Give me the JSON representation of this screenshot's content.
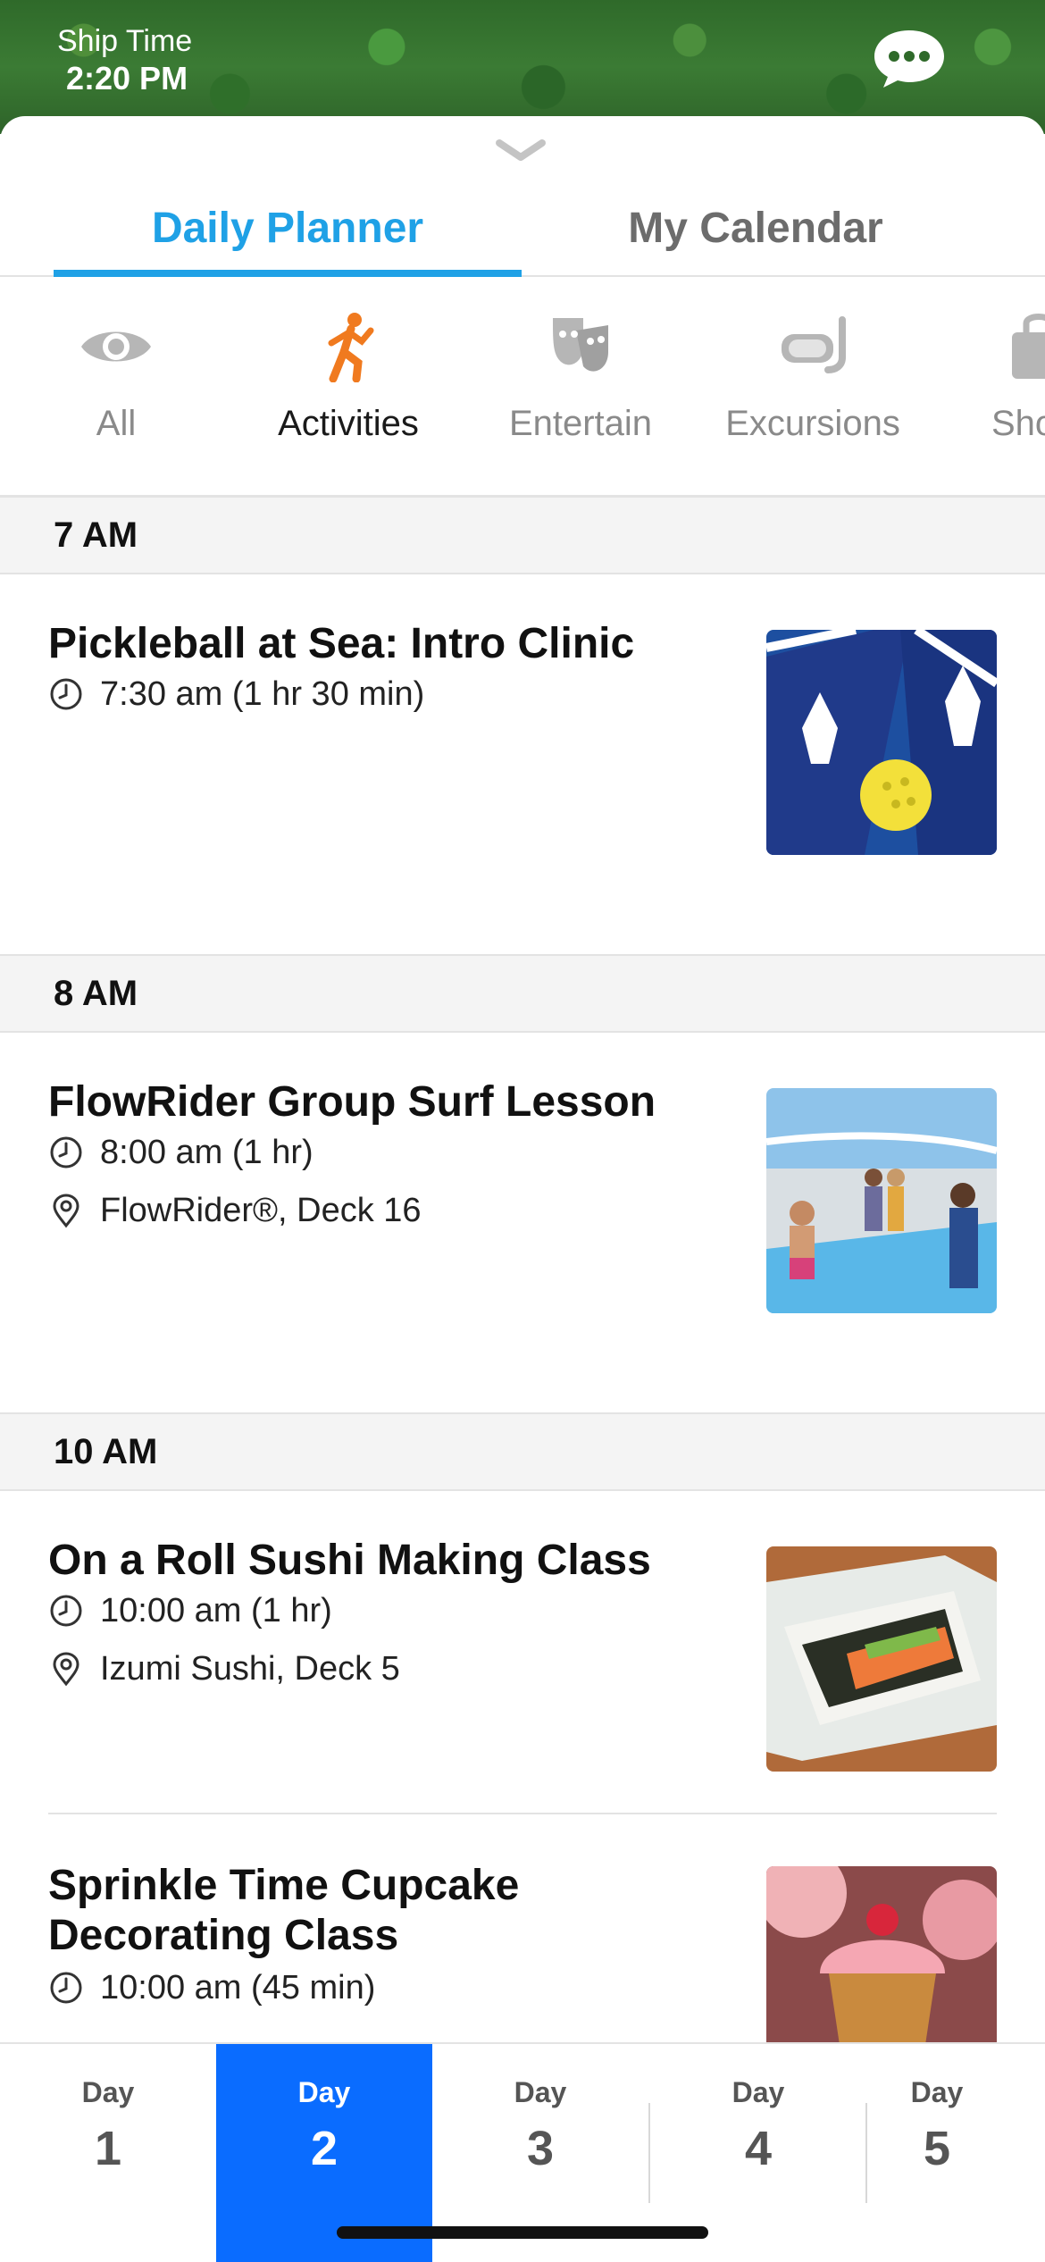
{
  "header": {
    "ship_time_label": "Ship Time",
    "ship_time_value": "2:20 PM"
  },
  "tabs": [
    {
      "label": "Daily Planner",
      "active": true
    },
    {
      "label": "My Calendar",
      "active": false
    }
  ],
  "categories": [
    {
      "label": "All",
      "icon": "eye-icon",
      "active": false
    },
    {
      "label": "Activities",
      "icon": "person-activity-icon",
      "active": true
    },
    {
      "label": "Entertain",
      "icon": "theater-masks-icon",
      "active": false
    },
    {
      "label": "Excursions",
      "icon": "snorkel-mask-icon",
      "active": false
    },
    {
      "label": "Sho",
      "icon": "shopping-bag-icon",
      "active": false
    }
  ],
  "sections": [
    {
      "time": "7 AM",
      "events": [
        {
          "title": "Pickleball at Sea: Intro Clinic",
          "time": "7:30 am (1 hr 30 min)",
          "location": ""
        }
      ]
    },
    {
      "time": "8 AM",
      "events": [
        {
          "title": "FlowRider Group Surf Lesson",
          "time": "8:00 am (1 hr)",
          "location": "FlowRider®, Deck 16"
        }
      ]
    },
    {
      "time": "10 AM",
      "events": [
        {
          "title": "On a Roll Sushi Making Class",
          "time": "10:00 am (1 hr)",
          "location": "Izumi Sushi, Deck 5"
        },
        {
          "title_line1": "Sprinkle Time Cupcake",
          "title_line2": "Decorating Class",
          "time": "10:00 am (45 min)",
          "location": ""
        }
      ]
    }
  ],
  "days": [
    {
      "word": "Day",
      "num": "1",
      "active": false
    },
    {
      "word": "Day",
      "num": "2",
      "active": true
    },
    {
      "word": "Day",
      "num": "3",
      "active": false
    },
    {
      "word": "Day",
      "num": "4",
      "active": false
    },
    {
      "word": "Day",
      "num": "5",
      "active": false
    }
  ],
  "colors": {
    "accent_blue": "#1fa1e6",
    "day_active": "#0a6cff",
    "activity_orange": "#f07a1f"
  }
}
